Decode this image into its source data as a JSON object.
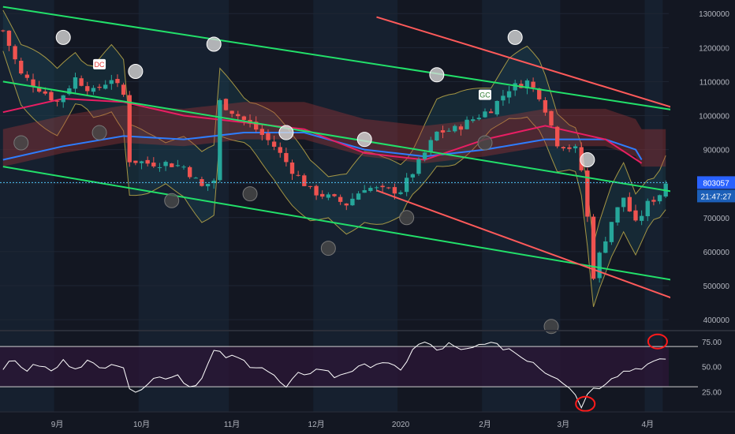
{
  "theme": {
    "background": "#131722",
    "band_a": "#16202f",
    "band_b": "#131722",
    "candle_up": "#26a69a",
    "candle_down": "#ef5350",
    "channel_green": "#22e06a",
    "channel_red": "#ff5a5a",
    "ma_blue": "#2e7dff",
    "ma_pink": "#e91e63",
    "bb_yellow": "#c8b34a",
    "rsi_line": "#ffffff",
    "rsi_zone": "#2a1736",
    "circle_light": "#d8d8d8",
    "circle_dark": "#4a4a4a",
    "highlight_red": "#ff1a1a",
    "badge_blue": "#2962ff"
  },
  "chart_data": [
    {
      "type": "candlestick",
      "title": "",
      "xlabel": "",
      "ylabel": "",
      "ylim": [
        370000,
        1340000
      ],
      "yticks": [
        "1300000",
        "1200000",
        "1100000",
        "1000000",
        "900000",
        "800000",
        "700000",
        "600000",
        "500000",
        "400000"
      ],
      "ytick_values": [
        1300000,
        1200000,
        1100000,
        1000000,
        900000,
        800000,
        700000,
        600000,
        500000,
        400000
      ],
      "x_labels": [
        "9月",
        "10月",
        "11月",
        "12月",
        "2020",
        "2月",
        "3月",
        "4月"
      ],
      "x_label_index": [
        9,
        23,
        38,
        52,
        66,
        80,
        93,
        107
      ],
      "bar_count": 111,
      "close_path": [
        [
          0,
          1250000
        ],
        [
          3,
          1120000
        ],
        [
          6,
          1080000
        ],
        [
          9,
          1040000
        ],
        [
          12,
          1110000
        ],
        [
          15,
          1070000
        ],
        [
          18,
          1110000
        ],
        [
          20,
          1060000
        ],
        [
          21,
          870000
        ],
        [
          24,
          860000
        ],
        [
          27,
          860000
        ],
        [
          30,
          850000
        ],
        [
          33,
          790000
        ],
        [
          35,
          810000
        ],
        [
          36,
          1040000
        ],
        [
          39,
          1000000
        ],
        [
          42,
          960000
        ],
        [
          45,
          910000
        ],
        [
          48,
          840000
        ],
        [
          51,
          780000
        ],
        [
          54,
          760000
        ],
        [
          57,
          740000
        ],
        [
          60,
          790000
        ],
        [
          63,
          780000
        ],
        [
          66,
          780000
        ],
        [
          69,
          860000
        ],
        [
          72,
          950000
        ],
        [
          75,
          960000
        ],
        [
          78,
          990000
        ],
        [
          81,
          1020000
        ],
        [
          84,
          1080000
        ],
        [
          87,
          1100000
        ],
        [
          89,
          1060000
        ],
        [
          90,
          1020000
        ],
        [
          92,
          920000
        ],
        [
          95,
          900000
        ],
        [
          96,
          840000
        ],
        [
          97,
          700000
        ],
        [
          98,
          530000
        ],
        [
          99,
          590000
        ],
        [
          101,
          690000
        ],
        [
          103,
          760000
        ],
        [
          105,
          680000
        ],
        [
          107,
          740000
        ],
        [
          109,
          770000
        ],
        [
          110,
          803057
        ]
      ],
      "current_price": "803057",
      "countdown": "21:47:27",
      "series": [
        {
          "name": "",
          "kind": "channel-line",
          "color": "green",
          "points": [
            [
              0,
              1320000
            ],
            [
              110,
              1020000
            ]
          ]
        },
        {
          "name": "",
          "kind": "channel-line",
          "color": "green",
          "points": [
            [
              0,
              1100000
            ],
            [
              110,
              780000
            ]
          ]
        },
        {
          "name": "",
          "kind": "channel-line",
          "color": "green",
          "points": [
            [
              0,
              850000
            ],
            [
              110,
              520000
            ]
          ]
        },
        {
          "name": "",
          "kind": "channel-line",
          "color": "red",
          "points": [
            [
              62,
              1290000
            ],
            [
              110,
              1030000
            ]
          ]
        },
        {
          "name": "",
          "kind": "channel-line",
          "color": "red",
          "points": [
            [
              62,
              780000
            ],
            [
              110,
              470000
            ]
          ]
        },
        {
          "name": "",
          "kind": "moving-average",
          "color": "blue",
          "points": [
            [
              0,
              870000
            ],
            [
              10,
              910000
            ],
            [
              20,
              940000
            ],
            [
              30,
              930000
            ],
            [
              40,
              950000
            ],
            [
              50,
              950000
            ],
            [
              60,
              900000
            ],
            [
              70,
              880000
            ],
            [
              80,
              900000
            ],
            [
              90,
              930000
            ],
            [
              100,
              930000
            ],
            [
              105,
              900000
            ],
            [
              106,
              870000
            ]
          ]
        },
        {
          "name": "",
          "kind": "moving-average",
          "color": "pink",
          "points": [
            [
              0,
              1010000
            ],
            [
              10,
              1050000
            ],
            [
              20,
              1040000
            ],
            [
              30,
              1000000
            ],
            [
              40,
              980000
            ],
            [
              50,
              960000
            ],
            [
              60,
              890000
            ],
            [
              70,
              870000
            ],
            [
              80,
              930000
            ],
            [
              90,
              970000
            ],
            [
              100,
              930000
            ],
            [
              106,
              860000
            ]
          ]
        }
      ],
      "signals": [
        {
          "label": "DC",
          "index": 16,
          "value": 1150000
        },
        {
          "label": "GC",
          "index": 80,
          "value": 1060000
        }
      ],
      "circles": [
        {
          "index": 10,
          "value": 1230000,
          "tone": "light"
        },
        {
          "index": 22,
          "value": 1130000,
          "tone": "light"
        },
        {
          "index": 35,
          "value": 1210000,
          "tone": "light"
        },
        {
          "index": 47,
          "value": 950000,
          "tone": "light"
        },
        {
          "index": 60,
          "value": 930000,
          "tone": "light"
        },
        {
          "index": 72,
          "value": 1120000,
          "tone": "light"
        },
        {
          "index": 85,
          "value": 1230000,
          "tone": "light"
        },
        {
          "index": 97,
          "value": 870000,
          "tone": "light"
        },
        {
          "index": 3,
          "value": 920000,
          "tone": "dark"
        },
        {
          "index": 16,
          "value": 950000,
          "tone": "dark"
        },
        {
          "index": 28,
          "value": 750000,
          "tone": "dark"
        },
        {
          "index": 41,
          "value": 770000,
          "tone": "dark"
        },
        {
          "index": 54,
          "value": 610000,
          "tone": "dark"
        },
        {
          "index": 67,
          "value": 700000,
          "tone": "dark"
        },
        {
          "index": 80,
          "value": 920000,
          "tone": "dark"
        },
        {
          "index": 91,
          "value": 380000,
          "tone": "dark"
        }
      ]
    },
    {
      "type": "line",
      "title": "",
      "xlabel": "",
      "ylabel": "",
      "ylim": [
        5,
        85
      ],
      "yticks": [
        "75.00",
        "50.00",
        "25.00"
      ],
      "ytick_values": [
        75,
        50,
        25
      ],
      "bands": [
        30,
        70
      ],
      "bar_count": 111,
      "values_path": [
        [
          0,
          50
        ],
        [
          2,
          55
        ],
        [
          4,
          47
        ],
        [
          6,
          52
        ],
        [
          8,
          45
        ],
        [
          10,
          55
        ],
        [
          12,
          50
        ],
        [
          14,
          55
        ],
        [
          16,
          48
        ],
        [
          18,
          55
        ],
        [
          20,
          50
        ],
        [
          21,
          25
        ],
        [
          23,
          30
        ],
        [
          25,
          38
        ],
        [
          27,
          40
        ],
        [
          29,
          42
        ],
        [
          31,
          30
        ],
        [
          33,
          38
        ],
        [
          35,
          65
        ],
        [
          37,
          60
        ],
        [
          39,
          58
        ],
        [
          41,
          52
        ],
        [
          43,
          50
        ],
        [
          45,
          40
        ],
        [
          47,
          28
        ],
        [
          49,
          42
        ],
        [
          51,
          45
        ],
        [
          53,
          48
        ],
        [
          55,
          40
        ],
        [
          57,
          45
        ],
        [
          59,
          48
        ],
        [
          61,
          52
        ],
        [
          63,
          55
        ],
        [
          66,
          45
        ],
        [
          68,
          68
        ],
        [
          70,
          74
        ],
        [
          72,
          66
        ],
        [
          74,
          72
        ],
        [
          76,
          65
        ],
        [
          78,
          68
        ],
        [
          80,
          75
        ],
        [
          82,
          70
        ],
        [
          84,
          68
        ],
        [
          86,
          60
        ],
        [
          88,
          55
        ],
        [
          90,
          45
        ],
        [
          92,
          40
        ],
        [
          94,
          30
        ],
        [
          95,
          22
        ],
        [
          96,
          10
        ],
        [
          97,
          25
        ],
        [
          99,
          30
        ],
        [
          101,
          40
        ],
        [
          103,
          45
        ],
        [
          105,
          48
        ],
        [
          107,
          52
        ],
        [
          109,
          55
        ],
        [
          110,
          58
        ]
      ],
      "highlights": [
        {
          "index": 108,
          "value": 75
        },
        {
          "index": 96,
          "value": 13
        }
      ]
    }
  ]
}
